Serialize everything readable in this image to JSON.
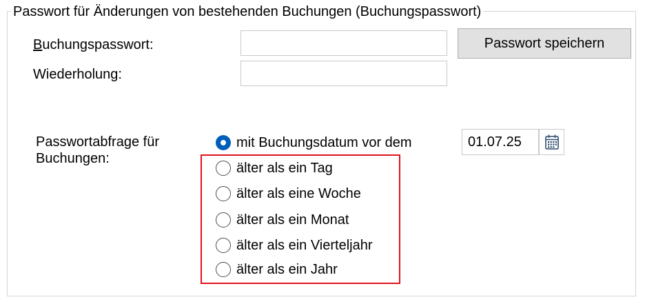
{
  "group": {
    "title": "Passwort für Änderungen von bestehenden Buchungen (Buchungspasswort)"
  },
  "password": {
    "label_accesskey": "B",
    "label_rest": "uchungspasswort:",
    "value": ""
  },
  "repeat": {
    "label": "Wiederholung:",
    "value": ""
  },
  "save_button": {
    "label": "Passwort speichern"
  },
  "query": {
    "label_line1": "Passwortabfrage für",
    "label_line2": "Buchungen:",
    "selected_index": 0,
    "options": [
      {
        "label": "mit Buchungsdatum vor dem"
      },
      {
        "label": "älter als ein Tag"
      },
      {
        "label": "älter als eine Woche"
      },
      {
        "label": "älter als ein Monat"
      },
      {
        "label": "älter als ein Vierteljahr"
      },
      {
        "label": "älter als ein Jahr"
      }
    ],
    "date_value": "01.07.25"
  },
  "colors": {
    "radio_selected": "#005fb8",
    "highlight_border": "#e0101a",
    "button_bg": "#e1e1e1"
  }
}
